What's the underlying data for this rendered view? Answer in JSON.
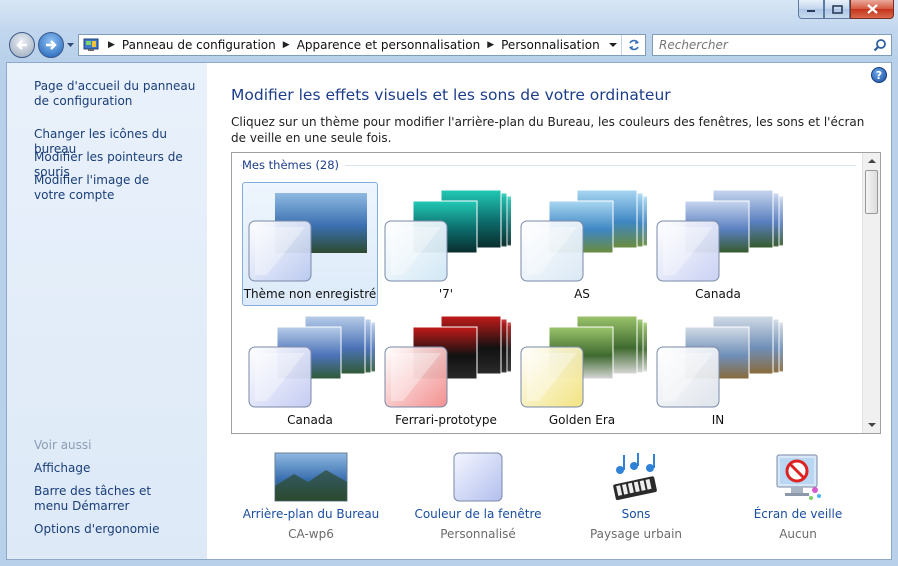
{
  "window": {
    "controls": [
      "minimize",
      "maximize",
      "close"
    ]
  },
  "address": {
    "breadcrumbs": [
      "Panneau de configuration",
      "Apparence et personnalisation",
      "Personnalisation"
    ]
  },
  "search": {
    "placeholder": "Rechercher"
  },
  "sidebar": {
    "links": [
      "Page d'accueil du panneau de configuration",
      "Changer les icônes du bureau",
      "Modifier les pointeurs de souris",
      "Modifier l'image de votre compte"
    ],
    "see_also_heading": "Voir aussi",
    "see_also": [
      "Affichage",
      "Barre des tâches et menu Démarrer",
      "Options d'ergonomie"
    ]
  },
  "main": {
    "title": "Modifier les effets visuels et les sons de votre ordinateur",
    "description": "Cliquez sur un thème pour modifier l'arrière-plan du Bureau, les couleurs des fenêtres, les sons et l'écran de veille en une seule fois.",
    "group_label": "Mes thèmes (28)",
    "themes": [
      {
        "name": "Thème non enregistré",
        "selected": true,
        "color": "#b9c8ef"
      },
      {
        "name": "'7'",
        "selected": false,
        "color": "#cfe6f5"
      },
      {
        "name": "AS",
        "selected": false,
        "color": "#d8e7f4"
      },
      {
        "name": "Canada",
        "selected": false,
        "color": "#c7cff3"
      },
      {
        "name": "Canada",
        "selected": false,
        "color": "#c2c9f2"
      },
      {
        "name": "Ferrari-prototype",
        "selected": false,
        "color": "#f28a8a"
      },
      {
        "name": "Golden Era",
        "selected": false,
        "color": "#f1e27a"
      },
      {
        "name": "IN",
        "selected": false,
        "color": "#dde2ea"
      }
    ]
  },
  "bottom": [
    {
      "label": "Arrière-plan du Bureau",
      "value": "CA-wp6",
      "icon": "desktop-background-icon"
    },
    {
      "label": "Couleur de la fenêtre",
      "value": "Personnalisé",
      "icon": "window-color-icon"
    },
    {
      "label": "Sons",
      "value": "Paysage urbain",
      "icon": "sounds-icon"
    },
    {
      "label": "Écran de veille",
      "value": "Aucun",
      "icon": "screensaver-icon"
    }
  ]
}
